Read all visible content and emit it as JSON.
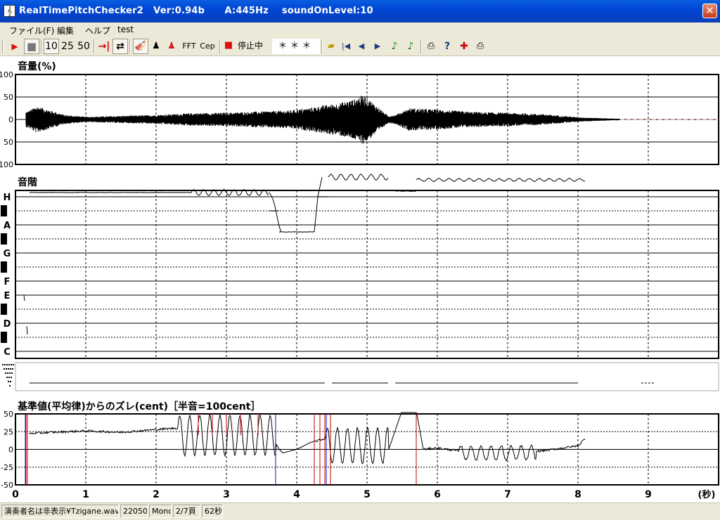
{
  "window": {
    "title": "RealTimePitchChecker2   Ver:0.94b      A:445Hz    soundOnLevel:10",
    "app_icon": "gclef-icon",
    "close_label": "✕"
  },
  "menu": [
    "ファイル(F)",
    "編集",
    "ヘルプ",
    "test"
  ],
  "toolbar": {
    "play_icon": "▶",
    "stop_icon": "■",
    "range10": "10",
    "range25": "25",
    "range50": "50",
    "fft_label": "FFT",
    "cep_label": "Cep",
    "state_label": "停止中",
    "note_display": "＊＊＊"
  },
  "panels": {
    "volume_title": "音量(%)",
    "pitch_title": "音階",
    "dev_title": "基準値(平均律)からのズレ(cent)［半音=100cent］"
  },
  "volume_axis": [
    "100",
    "50",
    "0",
    "50",
    "100"
  ],
  "note_labels": [
    "H",
    "A",
    "G",
    "F",
    "E",
    "D",
    "C"
  ],
  "dev_axis": [
    "50",
    "25",
    "0",
    "-25",
    "-50"
  ],
  "time_axis": {
    "ticks": [
      "0",
      "1",
      "2",
      "3",
      "4",
      "5",
      "6",
      "7",
      "8",
      "9"
    ],
    "unit": "(秒)"
  },
  "statusbar": {
    "file": "演奏者名は非表示¥Tzigane.wav",
    "rate": "22050",
    "channel": "Mono",
    "page": "2/7頁",
    "length": "62秒"
  },
  "chart_data": [
    {
      "type": "area",
      "title": "音量(%)",
      "x_unit": "seconds",
      "xlim": [
        0,
        10
      ],
      "ylim": [
        -100,
        100
      ],
      "envelope_x": [
        0,
        0.1,
        0.2,
        0.3,
        0.5,
        0.7,
        1.0,
        1.5,
        2.0,
        2.5,
        3.0,
        3.5,
        3.9,
        4.2,
        4.4,
        4.6,
        4.8,
        4.95,
        5.1,
        5.3,
        5.4,
        5.6,
        5.8,
        6.0,
        6.5,
        7.0,
        7.5,
        8.0,
        8.5,
        9.0,
        10.0
      ],
      "envelope_y": [
        5,
        15,
        20,
        30,
        20,
        10,
        6,
        8,
        10,
        14,
        15,
        18,
        20,
        26,
        32,
        36,
        44,
        55,
        35,
        8,
        10,
        25,
        24,
        22,
        17,
        15,
        12,
        5,
        2,
        1,
        1
      ]
    },
    {
      "type": "line",
      "title": "音階",
      "x_unit": "seconds",
      "xlim": [
        0,
        10
      ],
      "y_categories": [
        "C",
        "D",
        "E",
        "F",
        "G",
        "A",
        "H"
      ],
      "segments": [
        {
          "x": [
            0.2,
            2.5
          ],
          "note": 6.15,
          "vibrato": 0
        },
        {
          "x": [
            2.5,
            3.6
          ],
          "note": 6.15,
          "vibrato": 0.1
        },
        {
          "x": [
            3.6,
            3.75
          ],
          "note": 5.5,
          "vibrato": 0
        },
        {
          "x": [
            3.75,
            4.25
          ],
          "note": 4.75,
          "vibrato": 0
        },
        {
          "x": [
            4.3,
            4.45
          ],
          "note": 6.0,
          "vibrato": 0
        },
        {
          "x": [
            4.45,
            5.3
          ],
          "note": 6.7,
          "vibrato": 0.1
        },
        {
          "x": [
            5.4,
            5.7
          ],
          "note": 6.2,
          "vibrato": 0
        },
        {
          "x": [
            5.7,
            8.1
          ],
          "note": 6.6,
          "vibrato": 0.05
        }
      ]
    },
    {
      "type": "line",
      "title": "基準値(平均律)からのズレ(cent)［半音=100cent］",
      "x_unit": "seconds",
      "xlim": [
        0,
        10
      ],
      "ylim": [
        -50,
        50
      ],
      "points_x": [
        0.15,
        0.5,
        1.0,
        1.5,
        2.0,
        2.3,
        2.6,
        3.0,
        3.5,
        3.8,
        4.0,
        4.2,
        4.6,
        5.0,
        5.3,
        5.5,
        5.7,
        5.8,
        6.0,
        6.5,
        7.0,
        7.5,
        8.0,
        8.1
      ],
      "points_y": [
        22,
        24,
        26,
        24,
        28,
        30,
        35,
        32,
        30,
        -5,
        0,
        10,
        20,
        5,
        -2,
        55,
        55,
        0,
        2,
        -5,
        -5,
        -2,
        5,
        15
      ],
      "vibrato_ranges": [
        {
          "x": [
            2.3,
            3.7
          ],
          "amp": 28,
          "mid": 20
        },
        {
          "x": [
            4.4,
            5.3
          ],
          "amp": 25,
          "mid": 5
        },
        {
          "x": [
            6.3,
            7.4
          ],
          "amp": 10,
          "mid": -5
        }
      ]
    }
  ]
}
